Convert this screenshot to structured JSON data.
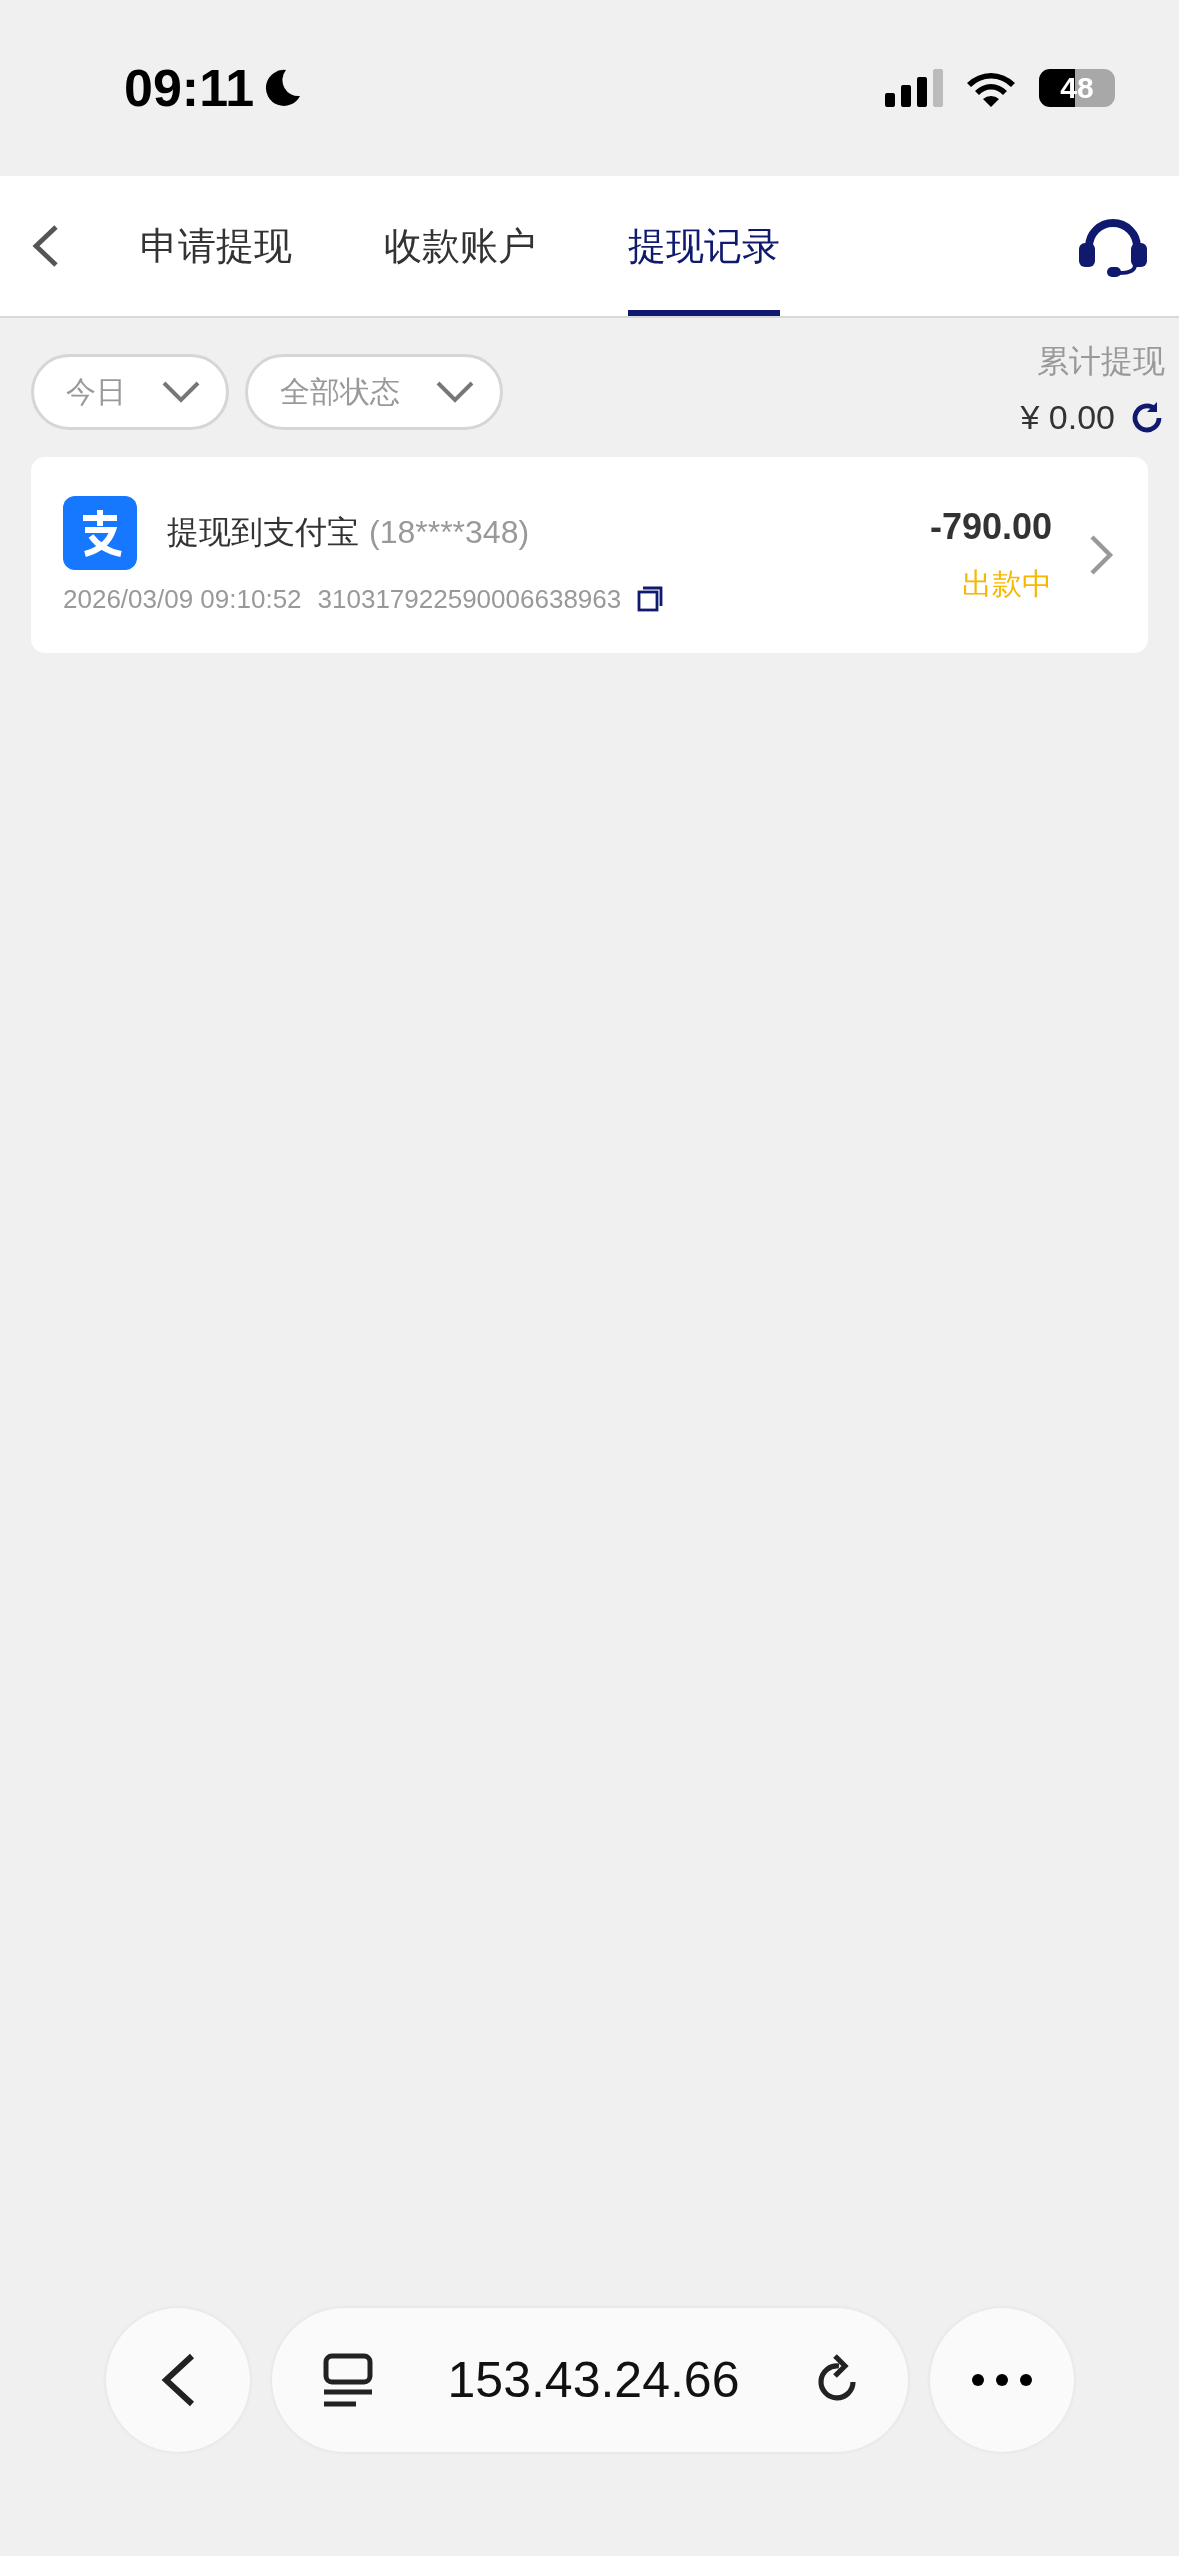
{
  "status_bar": {
    "time": "09:11",
    "battery": "48"
  },
  "tabs": [
    {
      "label": "申请提现",
      "selected": false
    },
    {
      "label": "收款账户",
      "selected": false
    },
    {
      "label": "提现记录",
      "selected": true
    }
  ],
  "filters": [
    {
      "label": "今日"
    },
    {
      "label": "全部状态"
    }
  ],
  "total": {
    "label": "累计提现",
    "amount": "¥ 0.00"
  },
  "records": [
    {
      "title": "提现到支付宝",
      "account": "(18****348)",
      "time": "2026/03/09 09:10:52",
      "order_no": "310317922590006638963",
      "amount": "-790.00",
      "status": "出款中",
      "color": "#f5b700"
    }
  ],
  "browser": {
    "url": "153.43.24.66"
  }
}
